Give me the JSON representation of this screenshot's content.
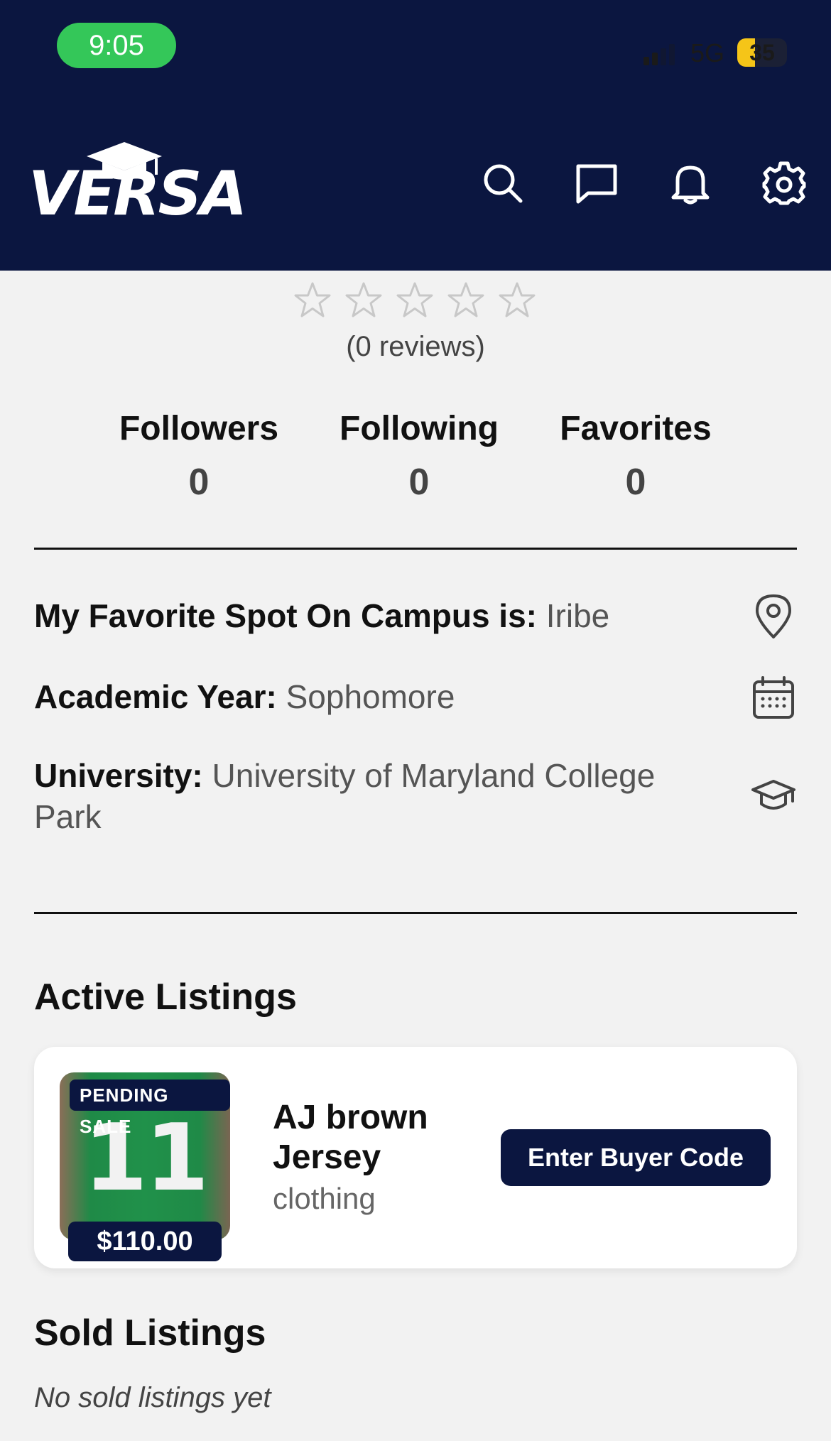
{
  "status_bar": {
    "time": "9:05",
    "network": "5G",
    "battery": "35",
    "battery_level": 0.35
  },
  "header": {
    "logo_text": "VERSA",
    "icons": [
      "search-icon",
      "chat-icon",
      "bell-icon",
      "gear-icon"
    ]
  },
  "rating": {
    "stars_filled": 0,
    "stars_total": 5,
    "reviews_text": "(0 reviews)"
  },
  "stats": [
    {
      "label": "Followers",
      "value": "0"
    },
    {
      "label": "Following",
      "value": "0"
    },
    {
      "label": "Favorites",
      "value": "0"
    }
  ],
  "profile_info": {
    "favorite_spot_label": "My Favorite Spot On Campus is:",
    "favorite_spot_value": "Iribe",
    "academic_year_label": "Academic Year:",
    "academic_year_value": "Sophomore",
    "university_label": "University:",
    "university_value": "University of Maryland College Park"
  },
  "active_listings": {
    "title": "Active Listings",
    "items": [
      {
        "badge": "PENDING SALE",
        "jersey_number": "11",
        "price": "$110.00",
        "name": "AJ brown Jersey",
        "category": "clothing",
        "action_label": "Enter Buyer Code"
      }
    ]
  },
  "sold_listings": {
    "title": "Sold Listings",
    "empty_text": "No sold listings yet"
  },
  "colors": {
    "brand_navy": "#0b1640",
    "status_green": "#34c759",
    "background": "#f2f2f2"
  }
}
